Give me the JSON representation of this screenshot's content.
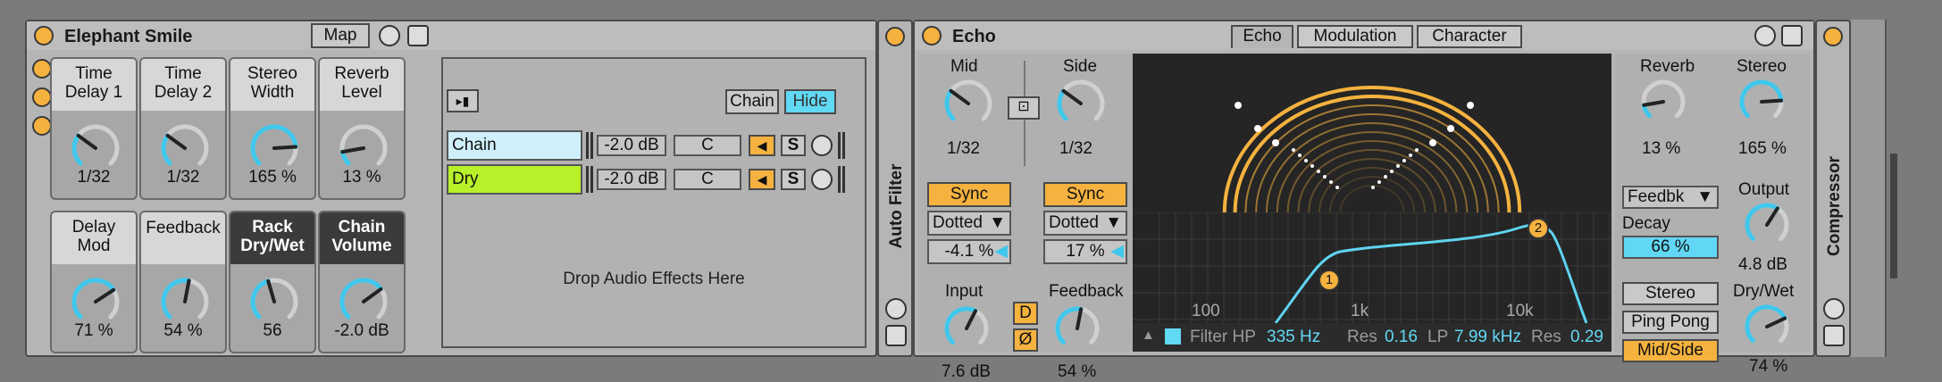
{
  "rack": {
    "title": "Elephant Smile",
    "map_label": "Map",
    "macros": [
      {
        "label": "Time\nDelay 1",
        "value": "1/32",
        "level": 0.3,
        "dark": false
      },
      {
        "label": "Time\nDelay 2",
        "value": "1/32",
        "level": 0.3,
        "dark": false
      },
      {
        "label": "Stereo\nWidth",
        "value": "165 %",
        "level": 0.82,
        "dark": false
      },
      {
        "label": "Reverb\nLevel",
        "value": "13 %",
        "level": 0.13,
        "dark": false
      },
      {
        "label": "Delay\nMod",
        "value": "71 %",
        "level": 0.71,
        "dark": false
      },
      {
        "label": "Feedback",
        "value": "54 %",
        "level": 0.54,
        "dark": false
      },
      {
        "label": "Rack\nDry/Wet",
        "value": "56",
        "level": 0.44,
        "dark": true
      },
      {
        "label": "Chain\nVolume",
        "value": "-2.0 dB",
        "level": 0.7,
        "dark": true
      }
    ],
    "chain_button": "Chain",
    "hide_button": "Hide",
    "chains": [
      {
        "name": "Chain",
        "volume": "-2.0 dB",
        "pan": "C",
        "solo": "S",
        "color": "#cfeffb"
      },
      {
        "name": "Dry",
        "volume": "-2.0 dB",
        "pan": "C",
        "solo": "S",
        "color": "#b8f02a"
      }
    ],
    "drop_text": "Drop Audio Effects Here"
  },
  "auto_filter": {
    "title": "Auto Filter"
  },
  "echo": {
    "title": "Echo",
    "tabs": [
      "Echo",
      "Modulation",
      "Character"
    ],
    "mid_label": "Mid",
    "side_label": "Side",
    "mid_value": "1/32",
    "side_value": "1/32",
    "sync_label": "Sync",
    "mode_left": "Dotted",
    "mode_right": "Dotted",
    "offset_left": "-4.1 %",
    "offset_right": "17 %",
    "input_label": "Input",
    "input_value": "7.6 dB",
    "d_label": "D",
    "phase_label": "Ø",
    "feedback_label": "Feedback",
    "feedback_value": "54 %",
    "freq_labels": [
      "100",
      "1k",
      "10k"
    ],
    "filter_hp_label": "Filter HP",
    "filter_hp_value": "335 Hz",
    "res_label": "Res",
    "res_hp_value": "0.16",
    "lp_label": "LP",
    "lp_value": "7.99 kHz",
    "res_lp_value": "0.29",
    "node1": "1",
    "node2": "2",
    "reverb_label": "Reverb",
    "reverb_value": "13 %",
    "stereo_label": "Stereo",
    "stereo_value": "165 %",
    "feedbk_select": "Feedbk",
    "decay_label": "Decay",
    "decay_value": "66 %",
    "output_label": "Output",
    "output_value": "4.8 dB",
    "drywet_label": "Dry/Wet",
    "drywet_value": "74 %",
    "mode_stereo": "Stereo",
    "mode_pingpong": "Ping Pong",
    "mode_midside": "Mid/Side"
  },
  "compressor": {
    "title": "Compressor"
  },
  "colors": {
    "accent": "#f5b23f",
    "cyan": "#61d8f4",
    "lime": "#b8f02a",
    "dark": "#252525"
  }
}
